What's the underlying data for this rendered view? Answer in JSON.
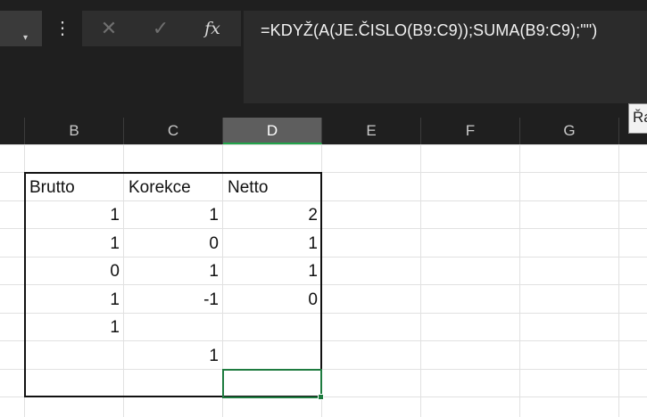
{
  "formula_bar": {
    "namebox_arrow": "▾",
    "more_icon": "⋮",
    "cancel_icon": "✕",
    "enter_icon": "✓",
    "fx_label": "fx",
    "formula": "=KDYŽ(A(JE.ČISLO(B9:C9));SUMA(B9:C9);\"\")"
  },
  "tooltip": {
    "text": "Řá"
  },
  "columns": [
    "B",
    "C",
    "D",
    "E",
    "F",
    "G"
  ],
  "active_column": "D",
  "table": {
    "headers": [
      "Brutto",
      "Korekce",
      "Netto"
    ],
    "rows": [
      [
        "1",
        "1",
        "2"
      ],
      [
        "1",
        "0",
        "1"
      ],
      [
        "0",
        "1",
        "1"
      ],
      [
        "1",
        "-1",
        "0"
      ],
      [
        "1",
        "",
        ""
      ],
      [
        "",
        "1",
        ""
      ],
      [
        "",
        "",
        ""
      ]
    ]
  },
  "colors": {
    "selection": "#1e7b3f",
    "active_header": "#5e5e5e",
    "header_bg": "#1f1f1f"
  }
}
